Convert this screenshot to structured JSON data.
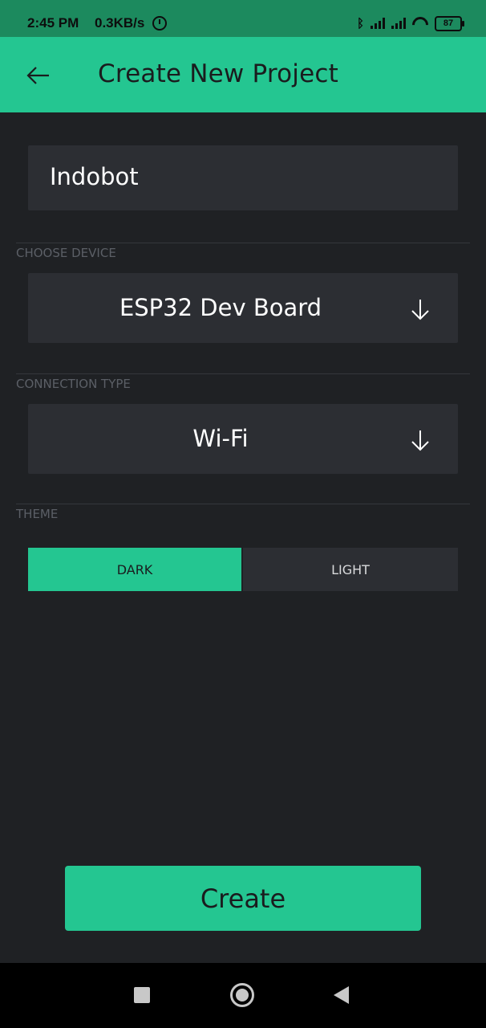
{
  "status": {
    "time": "2:45 PM",
    "speed": "0.3KB/s",
    "battery": "87"
  },
  "appbar": {
    "title": "Create New Project"
  },
  "form": {
    "project_name": "Indobot",
    "device_label": "CHOOSE DEVICE",
    "device_value": "ESP32 Dev Board",
    "connection_label": "CONNECTION TYPE",
    "connection_value": "Wi-Fi",
    "theme_label": "THEME",
    "theme_options": [
      "DARK",
      "LIGHT"
    ],
    "theme_selected": "DARK"
  },
  "actions": {
    "create_label": "Create"
  },
  "colors": {
    "accent": "#24c691",
    "background": "#1f2124",
    "field": "#2c2e33"
  },
  "icons": [
    "back-arrow-icon",
    "chevron-down-arrow-icon",
    "bluetooth-icon",
    "wifi-icon",
    "battery-icon",
    "alarm-icon",
    "nav-recents-icon",
    "nav-home-icon",
    "nav-back-icon"
  ]
}
